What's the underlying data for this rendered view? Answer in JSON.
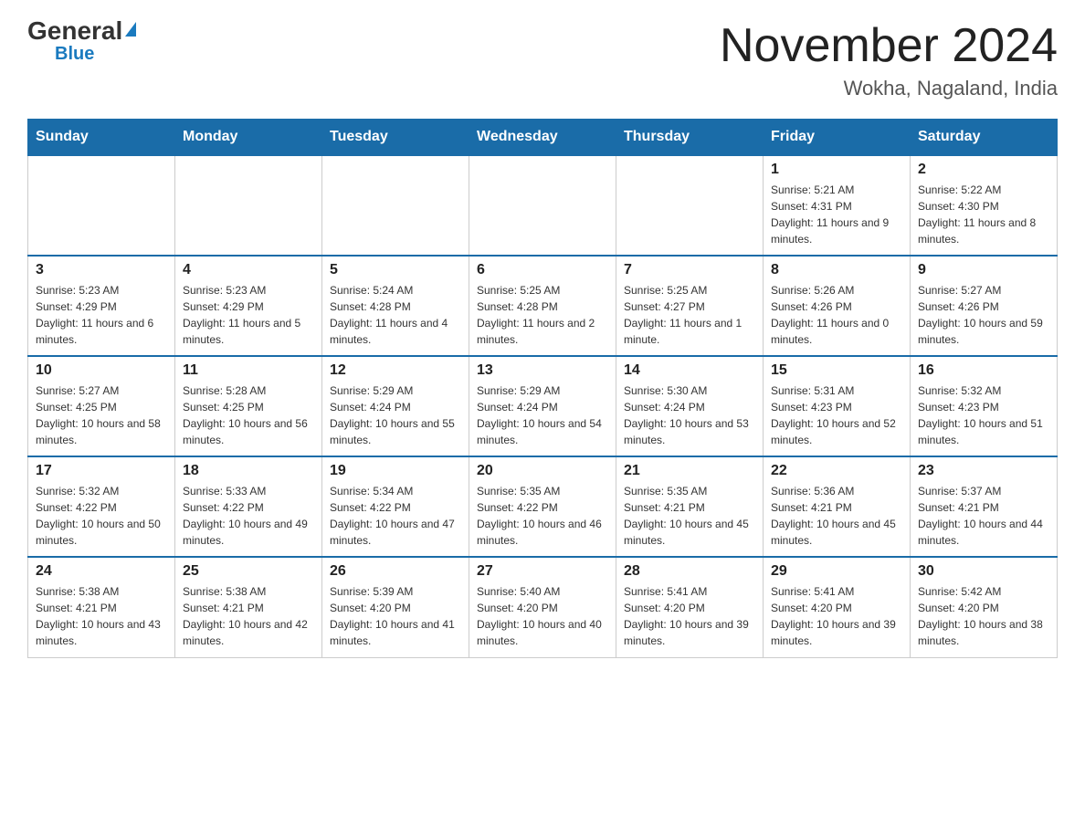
{
  "logo": {
    "general": "General",
    "blue": "Blue"
  },
  "header": {
    "month": "November 2024",
    "location": "Wokha, Nagaland, India"
  },
  "days_of_week": [
    "Sunday",
    "Monday",
    "Tuesday",
    "Wednesday",
    "Thursday",
    "Friday",
    "Saturday"
  ],
  "weeks": [
    [
      {
        "day": "",
        "info": ""
      },
      {
        "day": "",
        "info": ""
      },
      {
        "day": "",
        "info": ""
      },
      {
        "day": "",
        "info": ""
      },
      {
        "day": "",
        "info": ""
      },
      {
        "day": "1",
        "info": "Sunrise: 5:21 AM\nSunset: 4:31 PM\nDaylight: 11 hours and 9 minutes."
      },
      {
        "day": "2",
        "info": "Sunrise: 5:22 AM\nSunset: 4:30 PM\nDaylight: 11 hours and 8 minutes."
      }
    ],
    [
      {
        "day": "3",
        "info": "Sunrise: 5:23 AM\nSunset: 4:29 PM\nDaylight: 11 hours and 6 minutes."
      },
      {
        "day": "4",
        "info": "Sunrise: 5:23 AM\nSunset: 4:29 PM\nDaylight: 11 hours and 5 minutes."
      },
      {
        "day": "5",
        "info": "Sunrise: 5:24 AM\nSunset: 4:28 PM\nDaylight: 11 hours and 4 minutes."
      },
      {
        "day": "6",
        "info": "Sunrise: 5:25 AM\nSunset: 4:28 PM\nDaylight: 11 hours and 2 minutes."
      },
      {
        "day": "7",
        "info": "Sunrise: 5:25 AM\nSunset: 4:27 PM\nDaylight: 11 hours and 1 minute."
      },
      {
        "day": "8",
        "info": "Sunrise: 5:26 AM\nSunset: 4:26 PM\nDaylight: 11 hours and 0 minutes."
      },
      {
        "day": "9",
        "info": "Sunrise: 5:27 AM\nSunset: 4:26 PM\nDaylight: 10 hours and 59 minutes."
      }
    ],
    [
      {
        "day": "10",
        "info": "Sunrise: 5:27 AM\nSunset: 4:25 PM\nDaylight: 10 hours and 58 minutes."
      },
      {
        "day": "11",
        "info": "Sunrise: 5:28 AM\nSunset: 4:25 PM\nDaylight: 10 hours and 56 minutes."
      },
      {
        "day": "12",
        "info": "Sunrise: 5:29 AM\nSunset: 4:24 PM\nDaylight: 10 hours and 55 minutes."
      },
      {
        "day": "13",
        "info": "Sunrise: 5:29 AM\nSunset: 4:24 PM\nDaylight: 10 hours and 54 minutes."
      },
      {
        "day": "14",
        "info": "Sunrise: 5:30 AM\nSunset: 4:24 PM\nDaylight: 10 hours and 53 minutes."
      },
      {
        "day": "15",
        "info": "Sunrise: 5:31 AM\nSunset: 4:23 PM\nDaylight: 10 hours and 52 minutes."
      },
      {
        "day": "16",
        "info": "Sunrise: 5:32 AM\nSunset: 4:23 PM\nDaylight: 10 hours and 51 minutes."
      }
    ],
    [
      {
        "day": "17",
        "info": "Sunrise: 5:32 AM\nSunset: 4:22 PM\nDaylight: 10 hours and 50 minutes."
      },
      {
        "day": "18",
        "info": "Sunrise: 5:33 AM\nSunset: 4:22 PM\nDaylight: 10 hours and 49 minutes."
      },
      {
        "day": "19",
        "info": "Sunrise: 5:34 AM\nSunset: 4:22 PM\nDaylight: 10 hours and 47 minutes."
      },
      {
        "day": "20",
        "info": "Sunrise: 5:35 AM\nSunset: 4:22 PM\nDaylight: 10 hours and 46 minutes."
      },
      {
        "day": "21",
        "info": "Sunrise: 5:35 AM\nSunset: 4:21 PM\nDaylight: 10 hours and 45 minutes."
      },
      {
        "day": "22",
        "info": "Sunrise: 5:36 AM\nSunset: 4:21 PM\nDaylight: 10 hours and 45 minutes."
      },
      {
        "day": "23",
        "info": "Sunrise: 5:37 AM\nSunset: 4:21 PM\nDaylight: 10 hours and 44 minutes."
      }
    ],
    [
      {
        "day": "24",
        "info": "Sunrise: 5:38 AM\nSunset: 4:21 PM\nDaylight: 10 hours and 43 minutes."
      },
      {
        "day": "25",
        "info": "Sunrise: 5:38 AM\nSunset: 4:21 PM\nDaylight: 10 hours and 42 minutes."
      },
      {
        "day": "26",
        "info": "Sunrise: 5:39 AM\nSunset: 4:20 PM\nDaylight: 10 hours and 41 minutes."
      },
      {
        "day": "27",
        "info": "Sunrise: 5:40 AM\nSunset: 4:20 PM\nDaylight: 10 hours and 40 minutes."
      },
      {
        "day": "28",
        "info": "Sunrise: 5:41 AM\nSunset: 4:20 PM\nDaylight: 10 hours and 39 minutes."
      },
      {
        "day": "29",
        "info": "Sunrise: 5:41 AM\nSunset: 4:20 PM\nDaylight: 10 hours and 39 minutes."
      },
      {
        "day": "30",
        "info": "Sunrise: 5:42 AM\nSunset: 4:20 PM\nDaylight: 10 hours and 38 minutes."
      }
    ]
  ]
}
